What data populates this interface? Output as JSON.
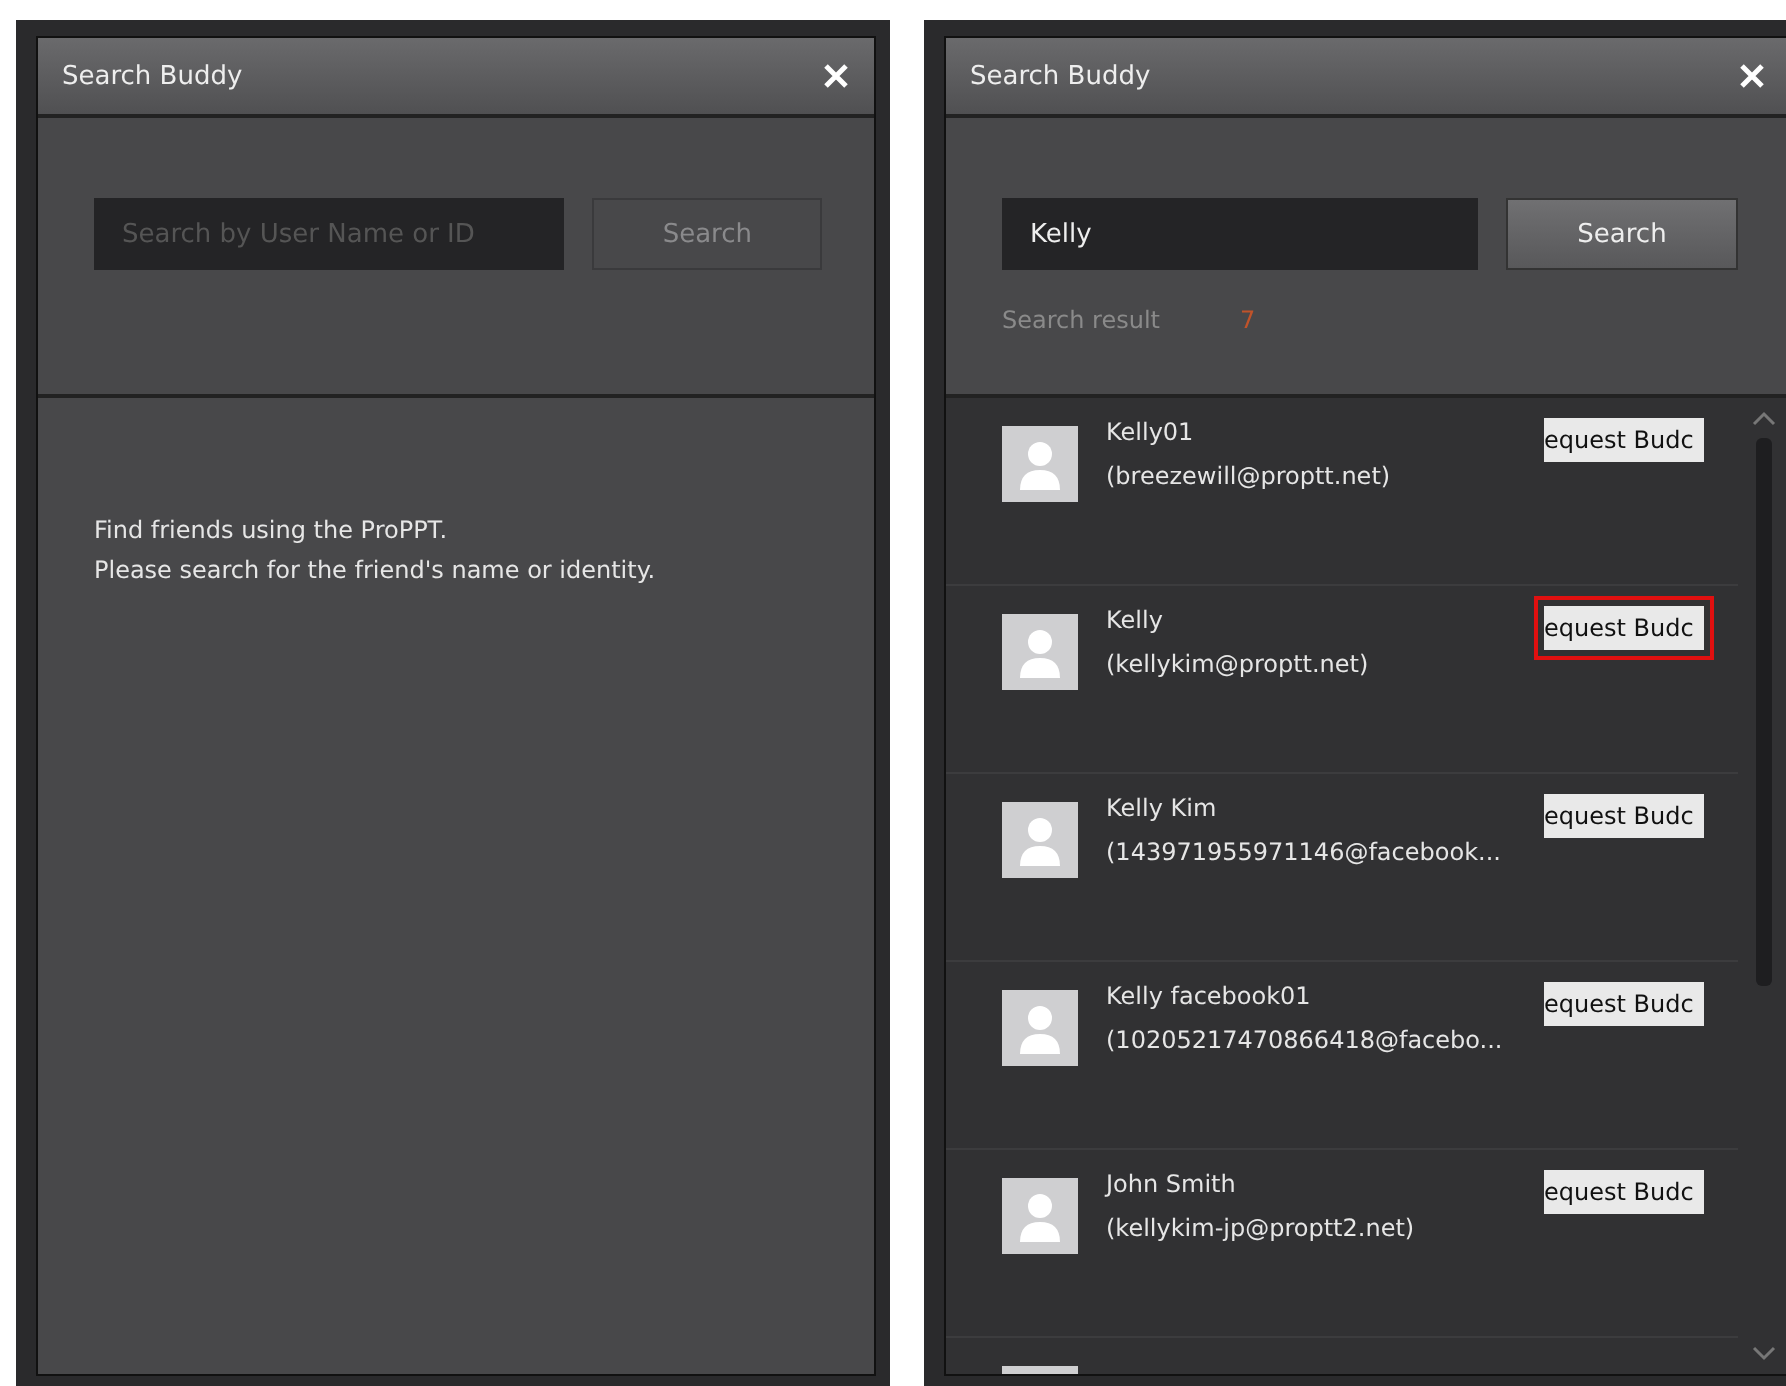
{
  "dialogs": [
    {
      "kind": "empty",
      "title": "Search Buddy",
      "search": {
        "placeholder": "Search by User Name or ID",
        "button": "Search",
        "disabled": true
      },
      "message": [
        "Find friends using the ProPPT.",
        "Please search for the friend's name or identity."
      ]
    },
    {
      "kind": "results",
      "title": "Search Buddy",
      "search": {
        "value": "Kelly",
        "button": "Search",
        "disabled": false
      },
      "result_label": "Search result",
      "result_count": "7",
      "results": [
        {
          "name": "Kelly01",
          "email": "(breezewill@proptt.net)",
          "button": "equest Budc",
          "highlighted": false
        },
        {
          "name": "Kelly",
          "email": "(kellykim@proptt.net)",
          "button": "equest Budc",
          "highlighted": true
        },
        {
          "name": "Kelly Kim",
          "email": "(143971955971146@facebook...",
          "button": "equest Budc",
          "highlighted": false
        },
        {
          "name": "Kelly facebook01",
          "email": "(10205217470866418@facebo...",
          "button": "equest Budc",
          "highlighted": false
        },
        {
          "name": "John Smith",
          "email": "(kellykim-jp@proptt2.net)",
          "button": "equest Budc",
          "highlighted": false
        }
      ]
    }
  ]
}
